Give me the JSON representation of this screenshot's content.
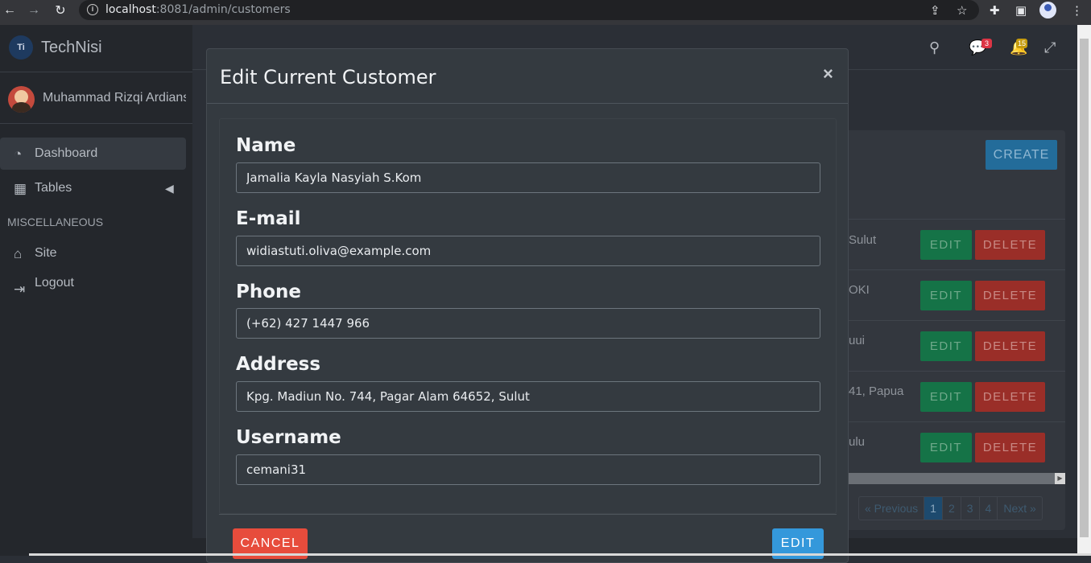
{
  "browser": {
    "url_host": "localhost",
    "url_rest": ":8081/admin/customers"
  },
  "sidebar": {
    "brand": "TechNisi",
    "brand_logo_text": "Ti",
    "user_name": "Muhammad Rizqi Ardiansyah",
    "items": [
      {
        "label": "Dashboard",
        "icon": "gauge-icon"
      },
      {
        "label": "Tables",
        "icon": "table-icon"
      }
    ],
    "section_header": "MISCELLANEOUS",
    "misc_items": [
      {
        "label": "Site",
        "icon": "home-icon"
      },
      {
        "label": "Logout",
        "icon": "logout-icon"
      }
    ]
  },
  "topbar": {
    "messages_badge": "3",
    "notifications_badge": "15"
  },
  "background_table": {
    "create_label": "CREATE",
    "rows": [
      {
        "address_fragment": "Sulut",
        "edit": "EDIT",
        "delete": "DELETE"
      },
      {
        "address_fragment": "OKI",
        "edit": "EDIT",
        "delete": "DELETE"
      },
      {
        "address_fragment": "uui",
        "edit": "EDIT",
        "delete": "DELETE"
      },
      {
        "address_fragment": "41, Papua",
        "edit": "EDIT",
        "delete": "DELETE"
      },
      {
        "address_fragment": "ulu",
        "edit": "EDIT",
        "delete": "DELETE"
      }
    ],
    "pagination": [
      "« Previous",
      "1",
      "2",
      "3",
      "4",
      "Next »"
    ]
  },
  "modal": {
    "title": "Edit Current Customer",
    "close": "×",
    "fields": [
      {
        "label": "Name",
        "value": "Jamalia Kayla Nasyiah S.Kom"
      },
      {
        "label": "E-mail",
        "value": "widiastuti.oliva@example.com"
      },
      {
        "label": "Phone",
        "value": "(+62) 427 1447 966"
      },
      {
        "label": "Address",
        "value": "Kpg. Madiun No. 744, Pagar Alam 64652, Sulut"
      },
      {
        "label": "Username",
        "value": "cemani31"
      }
    ],
    "cancel_label": "CANCEL",
    "edit_label": "EDIT"
  },
  "colors": {
    "cancel": "#e74c3c",
    "edit": "#3498db",
    "row_edit": "#157347",
    "row_delete": "#9a2e28"
  }
}
